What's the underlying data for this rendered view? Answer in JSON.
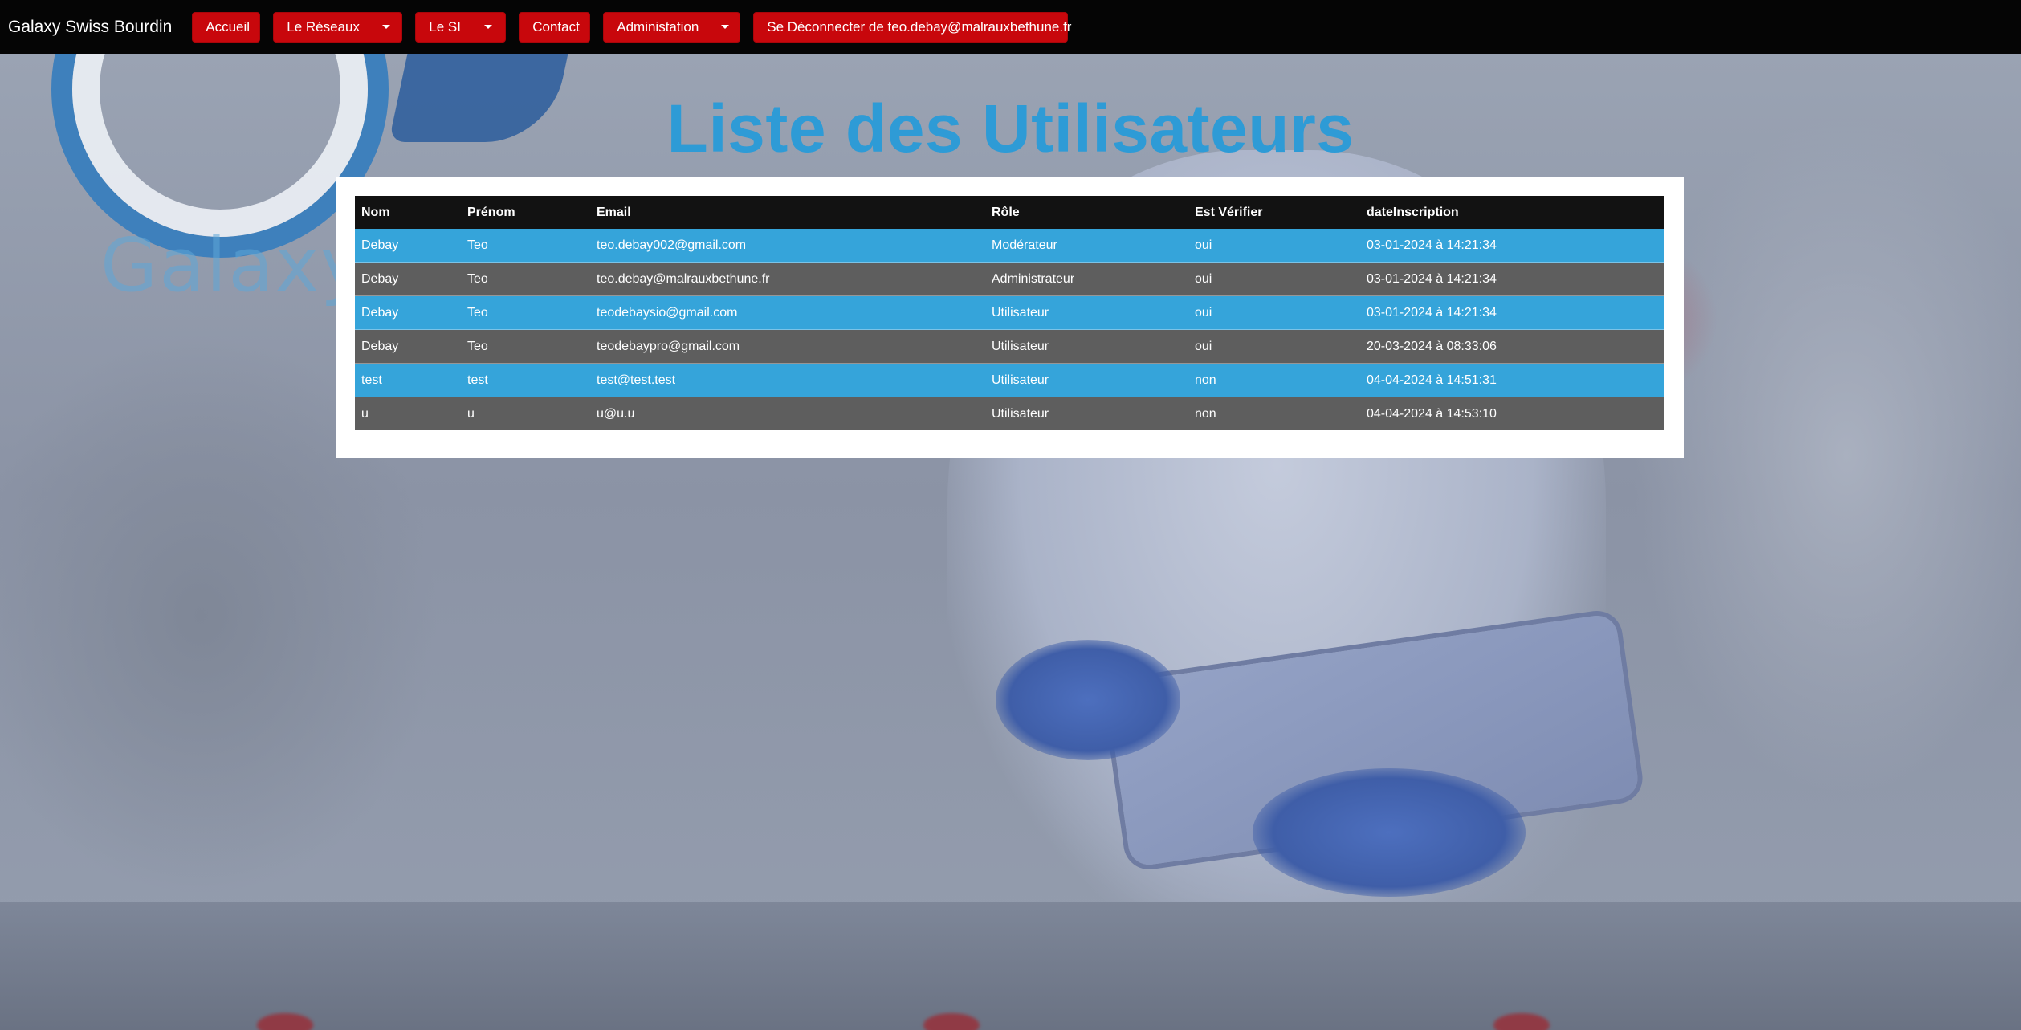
{
  "navbar": {
    "brand": "Galaxy Swiss Bourdin",
    "items": [
      {
        "label": "Accueil"
      },
      {
        "label": "Le Réseaux"
      },
      {
        "label": "Le SI"
      },
      {
        "label": "Contact"
      },
      {
        "label": "Administation"
      },
      {
        "label": "Se Déconnecter de teo.debay@malrauxbethune.fr"
      }
    ]
  },
  "background": {
    "logo_text": "Galaxy S"
  },
  "main": {
    "title": "Liste des Utilisateurs",
    "table": {
      "headers": [
        "Nom",
        "Prénom",
        "Email",
        "Rôle",
        "Est Vérifier",
        "dateInscription"
      ],
      "rows": [
        [
          "Debay",
          "Teo",
          "teo.debay002@gmail.com",
          "Modérateur",
          "oui",
          "03-01-2024 à 14:21:34"
        ],
        [
          "Debay",
          "Teo",
          "teo.debay@malrauxbethune.fr",
          "Administrateur",
          "oui",
          "03-01-2024 à 14:21:34"
        ],
        [
          "Debay",
          "Teo",
          "teodebaysio@gmail.com",
          "Utilisateur",
          "oui",
          "03-01-2024 à 14:21:34"
        ],
        [
          "Debay",
          "Teo",
          "teodebaypro@gmail.com",
          "Utilisateur",
          "oui",
          "20-03-2024 à 08:33:06"
        ],
        [
          "test",
          "test",
          "test@test.test",
          "Utilisateur",
          "non",
          "04-04-2024 à 14:51:31"
        ],
        [
          "u",
          "u",
          "u@u.u",
          "Utilisateur",
          "non",
          "04-04-2024 à 14:53:10"
        ]
      ]
    }
  },
  "colors": {
    "navbar_bg": "#050505",
    "nav_button": "#c8070c",
    "title": "#2e9bd6",
    "row_blue": "#35a4da",
    "row_grey": "#5e5e5e",
    "header_row": "#121212"
  }
}
